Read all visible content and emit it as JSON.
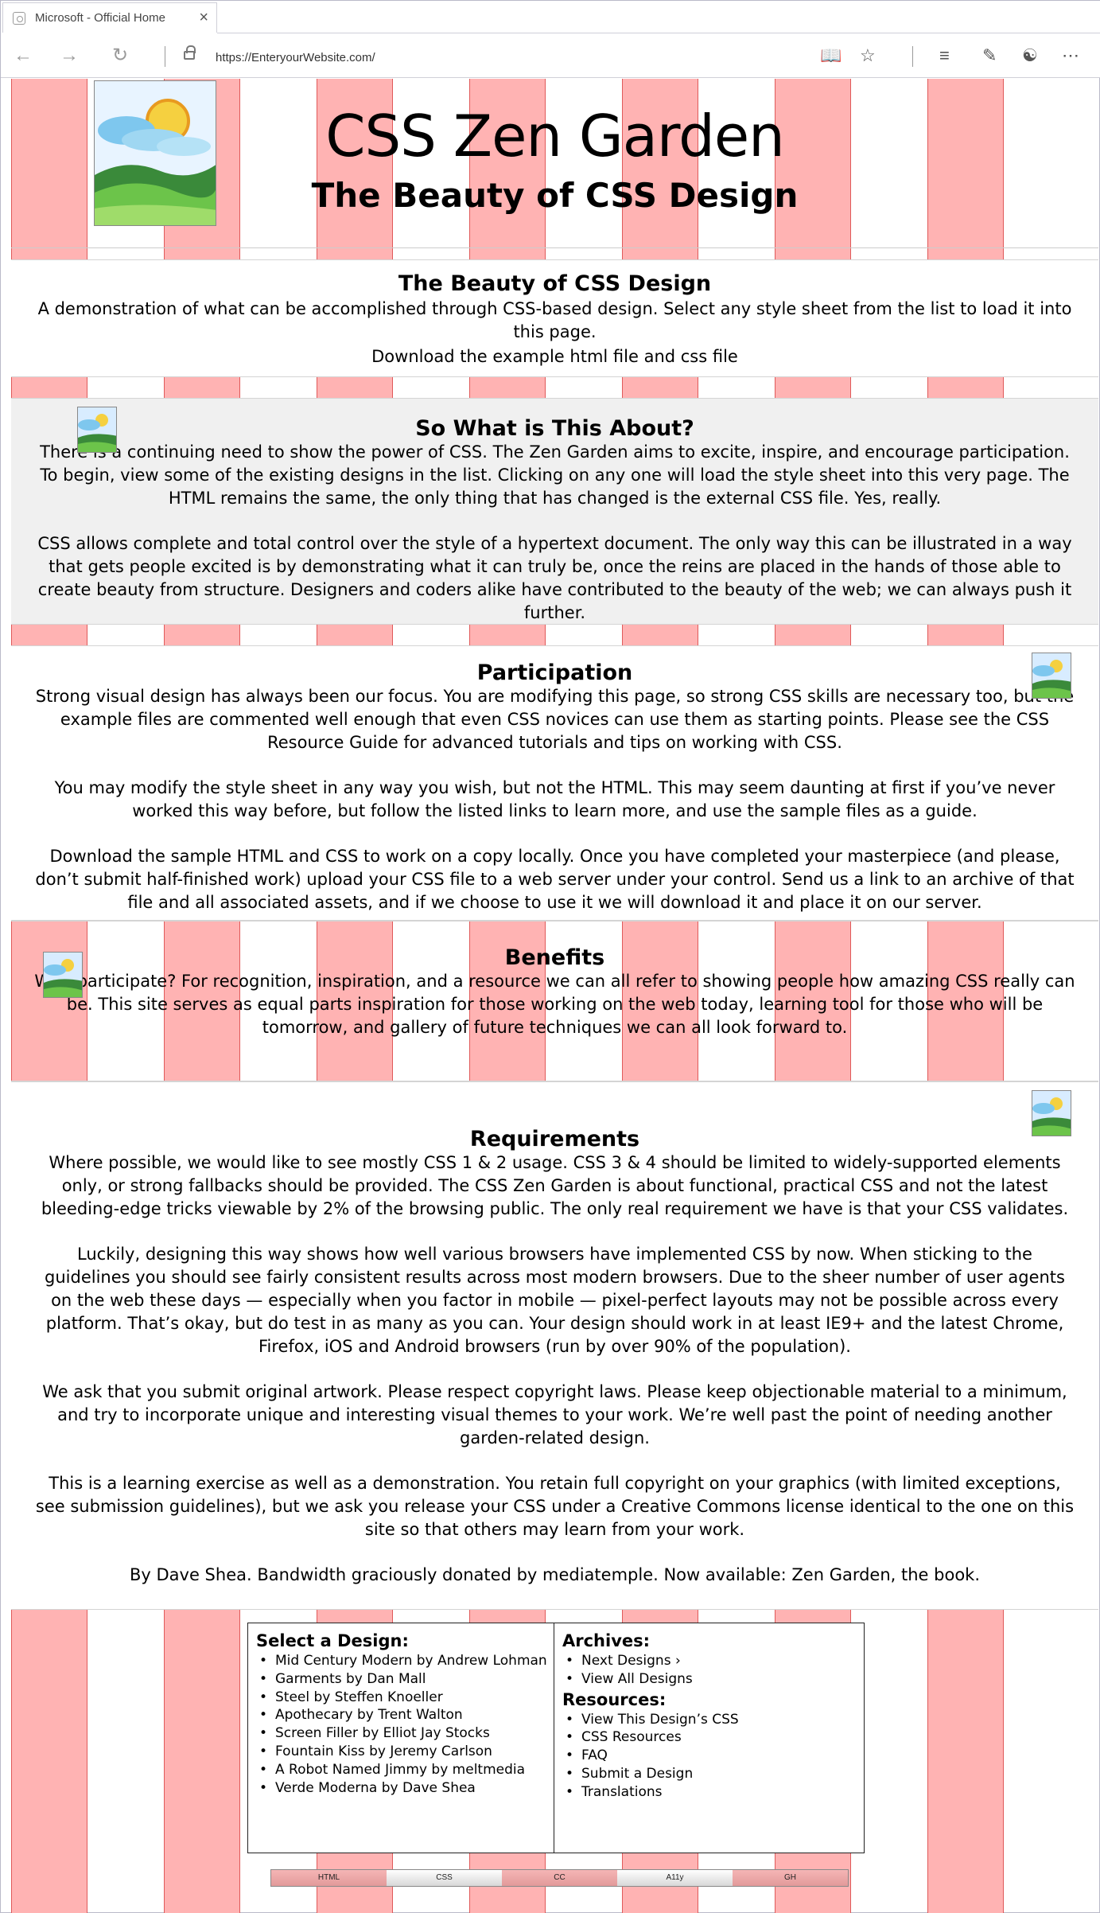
{
  "browser": {
    "tab_title": "Microsoft  - Official Home",
    "tab_close": "×",
    "url": "https://EnteryourWebsite.com/",
    "icons": [
      "back-icon",
      "forward-icon",
      "refresh-icon",
      "lock-icon",
      "reading-view-icon",
      "favorite-star-icon",
      "hub-icon",
      "web-note-icon",
      "share-icon",
      "more-icon"
    ]
  },
  "header": {
    "title": "CSS Zen Garden",
    "subtitle": "The Beauty of CSS Design"
  },
  "intro": {
    "heading": "The Beauty of CSS Design",
    "text": "A demonstration of what can be accomplished through CSS-based design. Select any style sheet from the list to load it into this page.",
    "download": "Download the example html file and css file"
  },
  "about": {
    "heading": "So What is This About?",
    "p1": "There is a continuing need to show the power of CSS. The Zen Garden aims to excite, inspire, and encourage participation. To begin, view some of the existing designs in the list. Clicking on any one will load the style sheet into this very page. The HTML remains the same, the only thing that has changed is the external CSS file. Yes, really.",
    "p2": "CSS allows complete and total control over the style of a hypertext document. The only way this can be illustrated in a way that gets people excited is by demonstrating what it can truly be, once the reins are placed in the hands of those able to create beauty from structure. Designers and coders alike have contributed to the beauty of the web; we can always push it further."
  },
  "participation": {
    "heading": "Participation",
    "p1": "Strong visual design has always been our focus. You are modifying this page, so strong CSS skills are necessary too, but the example files are commented well enough that even CSS novices can use them as starting points. Please see the CSS Resource Guide for advanced tutorials and tips on working with CSS.",
    "p2": "You may modify the style sheet in any way you wish, but not the HTML. This may seem daunting at first if you’ve never worked this way before, but follow the listed links to learn more, and use the sample files as a guide.",
    "p3": "Download the sample HTML and CSS to work on a copy locally. Once you have completed your masterpiece (and please, don’t submit half-finished work) upload your CSS file to a web server under your control. Send us a link to an archive of that file and all associated assets, and if we choose to use it we will download it and place it on our server."
  },
  "benefits": {
    "heading": "Benefits",
    "p1": "Why participate? For recognition, inspiration, and a resource we can all refer to showing people how amazing CSS really can be. This site serves as equal parts inspiration for those working on the web today, learning tool for those who will be tomorrow, and gallery of future techniques we can all look forward to."
  },
  "requirements": {
    "heading": "Requirements",
    "p1": "Where possible, we would like to see mostly CSS 1 & 2 usage. CSS 3 & 4 should be limited to widely-supported elements only, or strong fallbacks should be provided. The CSS Zen Garden is about functional, practical CSS and not the latest bleeding-edge tricks viewable by 2% of the browsing public. The only real requirement we have is that your CSS validates.",
    "p2": "Luckily, designing this way shows how well various browsers have implemented CSS by now. When sticking to the guidelines you should see fairly consistent results across most modern browsers. Due to the sheer number of user agents on the web these days — especially when you factor in mobile — pixel-perfect layouts may not be possible across every platform. That’s okay, but do test in as many as you can. Your design should work in at least IE9+ and the latest Chrome, Firefox, iOS and Android browsers (run by over 90% of the population).",
    "p3": "We ask that you submit original artwork. Please respect copyright laws. Please keep objectionable material to a minimum, and try to incorporate unique and interesting visual themes to your work. We’re well past the point of needing another garden-related design.",
    "p4": "This is a learning exercise as well as a demonstration. You retain full copyright on your graphics (with limited exceptions, see submission guidelines), but we ask you release your CSS under a Creative Commons license identical to the one on this site so that others may learn from your work.",
    "p5": "By Dave Shea. Bandwidth graciously donated by mediatemple. Now available: Zen Garden, the book."
  },
  "sidebar": {
    "select_heading": "Select a Design:",
    "designs": [
      "Mid Century Modern by Andrew Lohman",
      "Garments by Dan Mall",
      "Steel by Steffen Knoeller",
      "Apothecary by Trent Walton",
      "Screen Filler by Elliot Jay Stocks",
      "Fountain Kiss by Jeremy Carlson",
      "A Robot Named Jimmy by meltmedia",
      "Verde Moderna by Dave Shea"
    ],
    "archives_heading": "Archives:",
    "archives": [
      "Next Designs ›",
      "View All Designs"
    ],
    "resources_heading": "Resources:",
    "resources": [
      "View This Design’s CSS",
      "CSS Resources",
      "FAQ",
      "Submit a Design",
      "Translations"
    ]
  },
  "footer": {
    "links": [
      "HTML",
      "CSS",
      "CC",
      "A11y",
      "GH"
    ]
  },
  "colors": {
    "stripe": "#ffb3b3",
    "stripe_border": "#e05a5a",
    "about_bg": "#f0f0f0"
  }
}
